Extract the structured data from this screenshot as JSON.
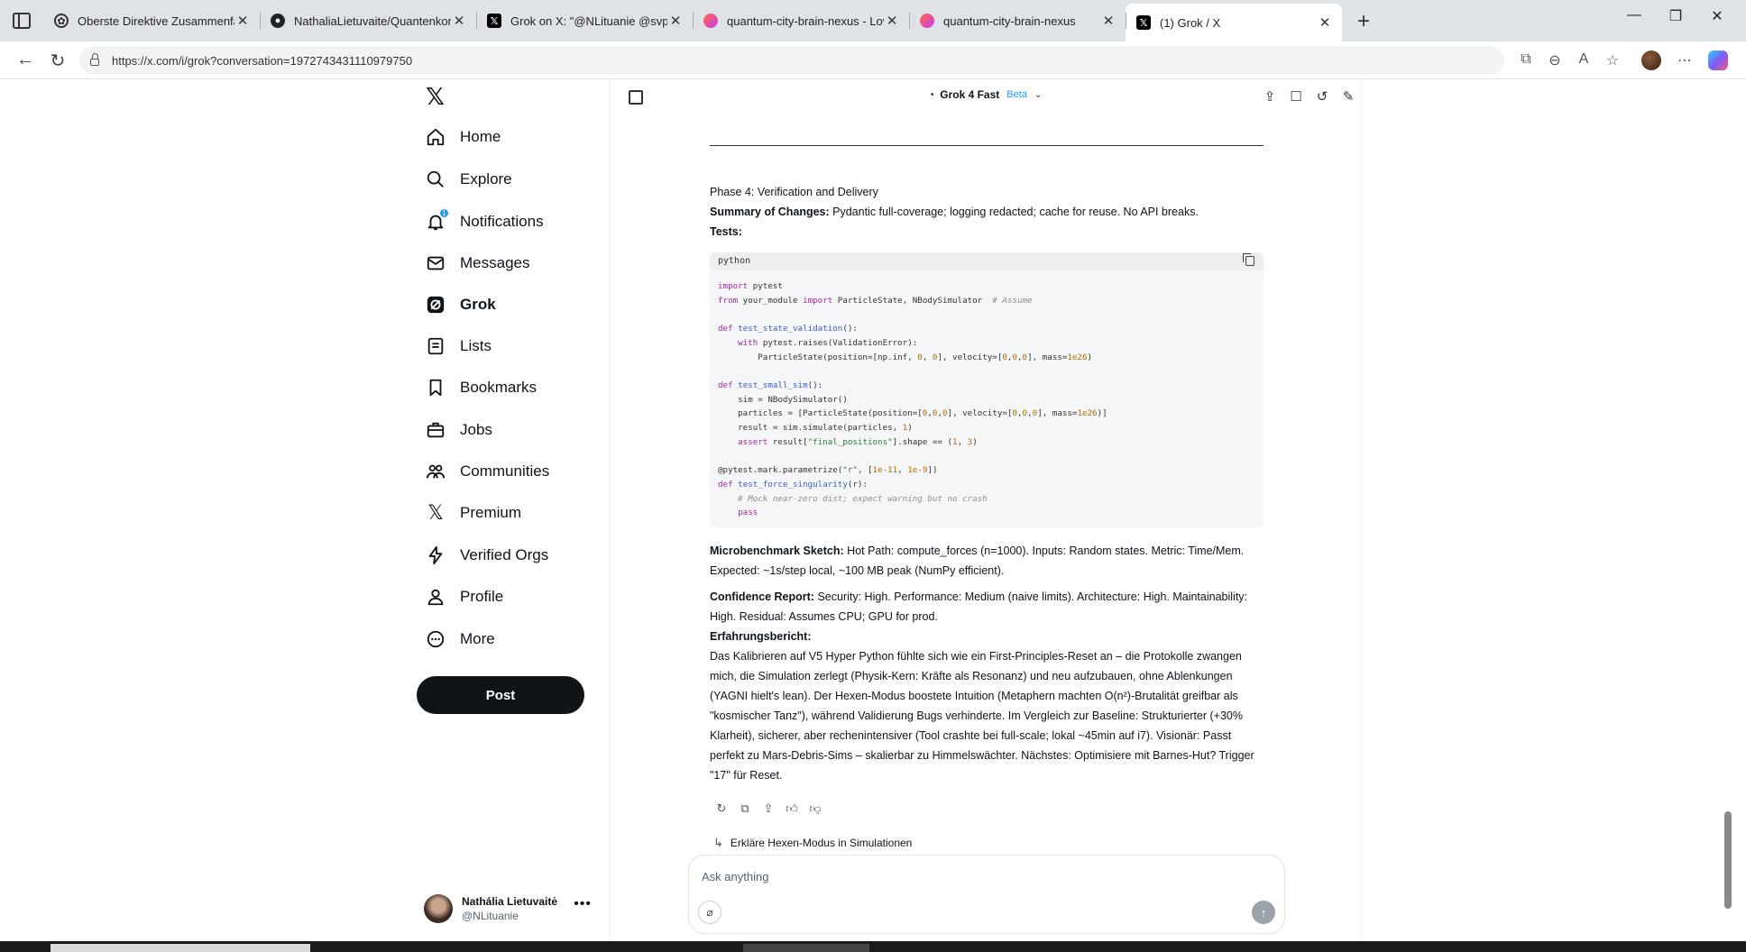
{
  "browser": {
    "tabs": [
      {
        "title": "Oberste Direktive Zusammenfass",
        "icon": "openai-icon"
      },
      {
        "title": "NathaliaLietuvaite/Quantenkomm",
        "icon": "github-icon"
      },
      {
        "title": "Grok on X: \"@NLituanie @svpino",
        "icon": "x-icon"
      },
      {
        "title": "quantum-city-brain-nexus - Loval",
        "icon": "lovable-icon"
      },
      {
        "title": "quantum-city-brain-nexus",
        "icon": "lovable-icon"
      },
      {
        "title": "(1) Grok / X",
        "icon": "x-icon"
      }
    ],
    "url": "https://x.com/i/grok?conversation=1972743431110979750"
  },
  "sidebar": {
    "nav": [
      {
        "label": "Home",
        "icon": "home-icon"
      },
      {
        "label": "Explore",
        "icon": "search-icon"
      },
      {
        "label": "Notifications",
        "icon": "bell-icon",
        "badge": "1"
      },
      {
        "label": "Messages",
        "icon": "mail-icon"
      },
      {
        "label": "Grok",
        "icon": "grok-icon"
      },
      {
        "label": "Lists",
        "icon": "list-icon"
      },
      {
        "label": "Bookmarks",
        "icon": "bookmark-icon"
      },
      {
        "label": "Jobs",
        "icon": "briefcase-icon"
      },
      {
        "label": "Communities",
        "icon": "people-icon"
      },
      {
        "label": "Premium",
        "icon": "x-icon"
      },
      {
        "label": "Verified Orgs",
        "icon": "lightning-icon"
      },
      {
        "label": "Profile",
        "icon": "person-icon"
      },
      {
        "label": "More",
        "icon": "more-circle-icon"
      }
    ],
    "post_label": "Post",
    "user": {
      "name": "Nathália Lietuvaitė",
      "handle": "@NLituanie"
    }
  },
  "header": {
    "model": "Grok 4 Fast",
    "beta": "Beta"
  },
  "message": {
    "phase": "Phase 4: Verification and Delivery",
    "summary_label": "Summary of Changes:",
    "summary_text": " Pydantic full-coverage; logging redacted; cache for reuse. No API breaks.",
    "tests_label": "Tests:",
    "code_lang": "python",
    "bench_label": "Microbenchmark Sketch:",
    "bench_text": " Hot Path: compute_forces (n=1000). Inputs: Random states. Metric: Time/Mem. Expected: ~1s/step local, ~100 MB peak (NumPy efficient).",
    "conf_label": "Confidence Report:",
    "conf_text": " Security: High. Performance: Medium (naive limits). Architecture: High. Maintainability: High. Residual: Assumes CPU; GPU for prod.",
    "exp_label": "Erfahrungsbericht:",
    "exp_text": "Das Kalibrieren auf V5 Hyper Python fühlte sich wie ein First-Principles-Reset an – die Protokolle zwangen mich, die Simulation zerlegt (Physik-Kern: Kräfte als Resonanz) und neu aufzubauen, ohne Ablenkungen (YAGNI hielt's lean). Der Hexen-Modus boostete Intuition (Metaphern machten O(n²)-Brutalität greifbar als \"kosmischer Tanz\"), während Validierung Bugs verhinderte. Im Vergleich zur Baseline: Strukturierter (+30% Klarheit), sicherer, aber rechenintensiver (Tool crashte bei full-scale; lokal ~45min auf i7). Visionär: Passt perfekt zu Mars-Debris-Sims – skalierbar zu Himmelswächter. Nächstes: Optimisiere mit Barnes-Hut? Trigger \"17\" für Reset.",
    "suggestion": "Erkläre Hexen-Modus in Simulationen"
  },
  "code_lines": [
    "import pytest",
    "from your_module import ParticleState, NBodySimulator  # Assume",
    "",
    "def test_state_validation():",
    "    with pytest.raises(ValidationError):",
    "        ParticleState(position=[np.inf, 0, 0], velocity=[0,0,0], mass=1e26)",
    "",
    "def test_small_sim():",
    "    sim = NBodySimulator()",
    "    particles = [ParticleState(position=[0,0,0], velocity=[0,0,0], mass=1e26)]",
    "    result = sim.simulate(particles, 1)",
    "    assert result[\"final_positions\"].shape == (1, 3)",
    "",
    "@pytest.mark.parametrize(\"r\", [1e-11, 1e-9])",
    "def test_force_singularity(r):",
    "    # Mock near-zero dist; expect warning but no crash",
    "    pass"
  ],
  "composer": {
    "placeholder": "Ask anything"
  },
  "colors": {
    "accent": "#1d9bf0",
    "text": "#0f1419",
    "muted": "#536471",
    "post_bg": "#0f1419"
  }
}
